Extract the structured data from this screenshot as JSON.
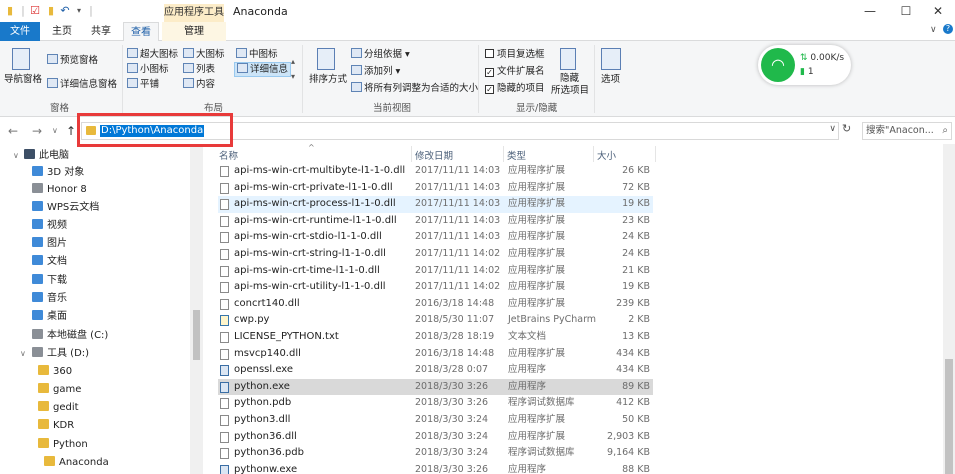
{
  "window": {
    "title": "Anaconda",
    "context_tab": "应用程序工具",
    "controls": {
      "minimize": "—",
      "maximize": "☐",
      "close": "✕"
    }
  },
  "tabs": {
    "file": "文件",
    "home": "主页",
    "share": "共享",
    "view": "查看",
    "manage": "管理"
  },
  "ribbon": {
    "panes": {
      "nav_pane": "导航窗格",
      "preview_pane": "预览窗格",
      "details_pane": "详细信息窗格",
      "group_label": "窗格"
    },
    "layout": {
      "extra_large": "超大图标",
      "large": "大图标",
      "medium": "中图标",
      "small": "小图标",
      "list": "列表",
      "details": "详细信息",
      "tiles": "平铺",
      "content": "内容",
      "group_label": "布局"
    },
    "current_view": {
      "sort_by": "排序方式",
      "group_by": "分组依据",
      "add_column": "添加列",
      "fit_columns": "将所有列调整为合适的大小",
      "group_label": "当前视图"
    },
    "show_hide": {
      "item_checkboxes": "项目复选框",
      "file_extensions": "文件扩展名",
      "hidden_items": "隐藏的项目",
      "hide_selected_line1": "隐藏",
      "hide_selected_line2": "所选项目",
      "group_label": "显示/隐藏",
      "item_checkboxes_checked": false,
      "file_extensions_checked": true,
      "hidden_items_checked": true
    },
    "options": "选项"
  },
  "wifi": {
    "speed": "0.00K/s",
    "count": "1",
    "accent": "#20b94b"
  },
  "address": {
    "path": "D:\\Python\\Anaconda",
    "search_placeholder": "搜索\"Anacon...",
    "back_icon": "←",
    "forward_icon": "→",
    "recent_icon": "∨",
    "up_icon": "↑",
    "refresh_icon": "↻",
    "search_icon": "⌕",
    "dropdown_icon": "∨"
  },
  "nav": {
    "items": [
      {
        "label": "此电脑",
        "icon": "pc-icon"
      },
      {
        "label": "3D 对象",
        "icon": "folder-3d-icon"
      },
      {
        "label": "Honor 8",
        "icon": "phone-icon"
      },
      {
        "label": "WPS云文档",
        "icon": "cloud-icon"
      },
      {
        "label": "视频",
        "icon": "video-folder-icon"
      },
      {
        "label": "图片",
        "icon": "pictures-folder-icon"
      },
      {
        "label": "文档",
        "icon": "documents-folder-icon"
      },
      {
        "label": "下载",
        "icon": "downloads-folder-icon"
      },
      {
        "label": "音乐",
        "icon": "music-folder-icon"
      },
      {
        "label": "桌面",
        "icon": "desktop-folder-icon"
      },
      {
        "label": "本地磁盘 (C:)",
        "icon": "drive-icon"
      },
      {
        "label": "工具 (D:)",
        "icon": "drive-icon"
      },
      {
        "label": "360",
        "icon": "folder-icon"
      },
      {
        "label": "game",
        "icon": "folder-icon"
      },
      {
        "label": "gedit",
        "icon": "folder-icon"
      },
      {
        "label": "KDR",
        "icon": "folder-icon"
      },
      {
        "label": "Python",
        "icon": "folder-icon"
      },
      {
        "label": "Anaconda",
        "icon": "folder-icon"
      }
    ]
  },
  "columns": {
    "name": "名称",
    "date": "修改日期",
    "type": "类型",
    "size": "大小"
  },
  "files": [
    {
      "name": "api-ms-win-crt-multibyte-l1-1-0.dll",
      "date": "2017/11/11 14:03",
      "type": "应用程序扩展",
      "size": "26 KB",
      "kind": "dll"
    },
    {
      "name": "api-ms-win-crt-private-l1-1-0.dll",
      "date": "2017/11/11 14:03",
      "type": "应用程序扩展",
      "size": "72 KB",
      "kind": "dll"
    },
    {
      "name": "api-ms-win-crt-process-l1-1-0.dll",
      "date": "2017/11/11 14:03",
      "type": "应用程序扩展",
      "size": "19 KB",
      "kind": "dll"
    },
    {
      "name": "api-ms-win-crt-runtime-l1-1-0.dll",
      "date": "2017/11/11 14:03",
      "type": "应用程序扩展",
      "size": "23 KB",
      "kind": "dll"
    },
    {
      "name": "api-ms-win-crt-stdio-l1-1-0.dll",
      "date": "2017/11/11 14:03",
      "type": "应用程序扩展",
      "size": "24 KB",
      "kind": "dll"
    },
    {
      "name": "api-ms-win-crt-string-l1-1-0.dll",
      "date": "2017/11/11 14:02",
      "type": "应用程序扩展",
      "size": "24 KB",
      "kind": "dll"
    },
    {
      "name": "api-ms-win-crt-time-l1-1-0.dll",
      "date": "2017/11/11 14:02",
      "type": "应用程序扩展",
      "size": "21 KB",
      "kind": "dll"
    },
    {
      "name": "api-ms-win-crt-utility-l1-1-0.dll",
      "date": "2017/11/11 14:02",
      "type": "应用程序扩展",
      "size": "19 KB",
      "kind": "dll"
    },
    {
      "name": "concrt140.dll",
      "date": "2016/3/18 14:48",
      "type": "应用程序扩展",
      "size": "239 KB",
      "kind": "dll"
    },
    {
      "name": "cwp.py",
      "date": "2018/5/30 11:07",
      "type": "JetBrains PyCharm",
      "size": "2 KB",
      "kind": "py"
    },
    {
      "name": "LICENSE_PYTHON.txt",
      "date": "2018/3/28 18:19",
      "type": "文本文档",
      "size": "13 KB",
      "kind": "txt"
    },
    {
      "name": "msvcp140.dll",
      "date": "2016/3/18 14:48",
      "type": "应用程序扩展",
      "size": "434 KB",
      "kind": "dll"
    },
    {
      "name": "openssl.exe",
      "date": "2018/3/28 0:07",
      "type": "应用程序",
      "size": "434 KB",
      "kind": "exe"
    },
    {
      "name": "python.exe",
      "date": "2018/3/30 3:26",
      "type": "应用程序",
      "size": "89 KB",
      "kind": "exe"
    },
    {
      "name": "python.pdb",
      "date": "2018/3/30 3:26",
      "type": "程序调试数据库",
      "size": "412 KB",
      "kind": "pdb"
    },
    {
      "name": "python3.dll",
      "date": "2018/3/30 3:24",
      "type": "应用程序扩展",
      "size": "50 KB",
      "kind": "dll"
    },
    {
      "name": "python36.dll",
      "date": "2018/3/30 3:24",
      "type": "应用程序扩展",
      "size": "2,903 KB",
      "kind": "dll"
    },
    {
      "name": "python36.pdb",
      "date": "2018/3/30 3:24",
      "type": "程序调试数据库",
      "size": "9,164 KB",
      "kind": "pdb"
    },
    {
      "name": "pythonw.exe",
      "date": "2018/3/30 3:26",
      "type": "应用程序",
      "size": "88 KB",
      "kind": "exe"
    }
  ],
  "state": {
    "hover_row": 2,
    "selected_row": 13,
    "selected_nav": 17,
    "highlight_color": "#e83a3a"
  }
}
